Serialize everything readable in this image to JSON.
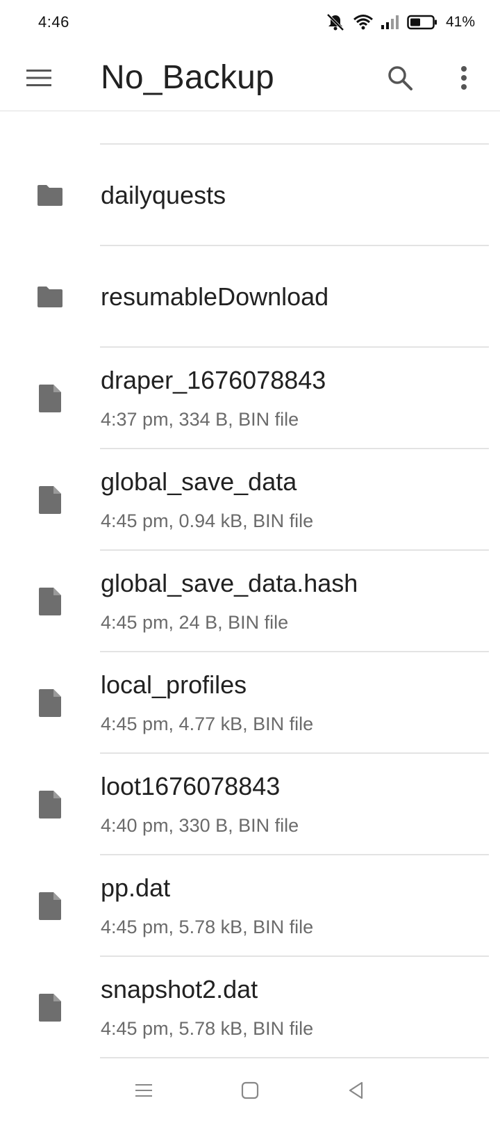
{
  "status_bar": {
    "time": "4:46",
    "battery_percent": "41%"
  },
  "app_bar": {
    "title": "No_Backup"
  },
  "folders": [
    {
      "name": "dailyquests"
    },
    {
      "name": "resumableDownload"
    }
  ],
  "files": [
    {
      "name": "draper_1676078843",
      "meta": "4:37 pm, 334 B, BIN file"
    },
    {
      "name": "global_save_data",
      "meta": "4:45 pm, 0.94 kB, BIN file"
    },
    {
      "name": "global_save_data.hash",
      "meta": "4:45 pm, 24 B, BIN file"
    },
    {
      "name": "local_profiles",
      "meta": "4:45 pm, 4.77 kB, BIN file"
    },
    {
      "name": "loot1676078843",
      "meta": "4:40 pm, 330 B, BIN file"
    },
    {
      "name": "pp.dat",
      "meta": "4:45 pm, 5.78 kB, BIN file"
    },
    {
      "name": "snapshot2.dat",
      "meta": "4:45 pm, 5.78 kB, BIN file"
    }
  ],
  "colors": {
    "icon_gray": "#6e6e6e",
    "divider": "#e3e3e3",
    "meta_text": "#6b6b6b"
  }
}
